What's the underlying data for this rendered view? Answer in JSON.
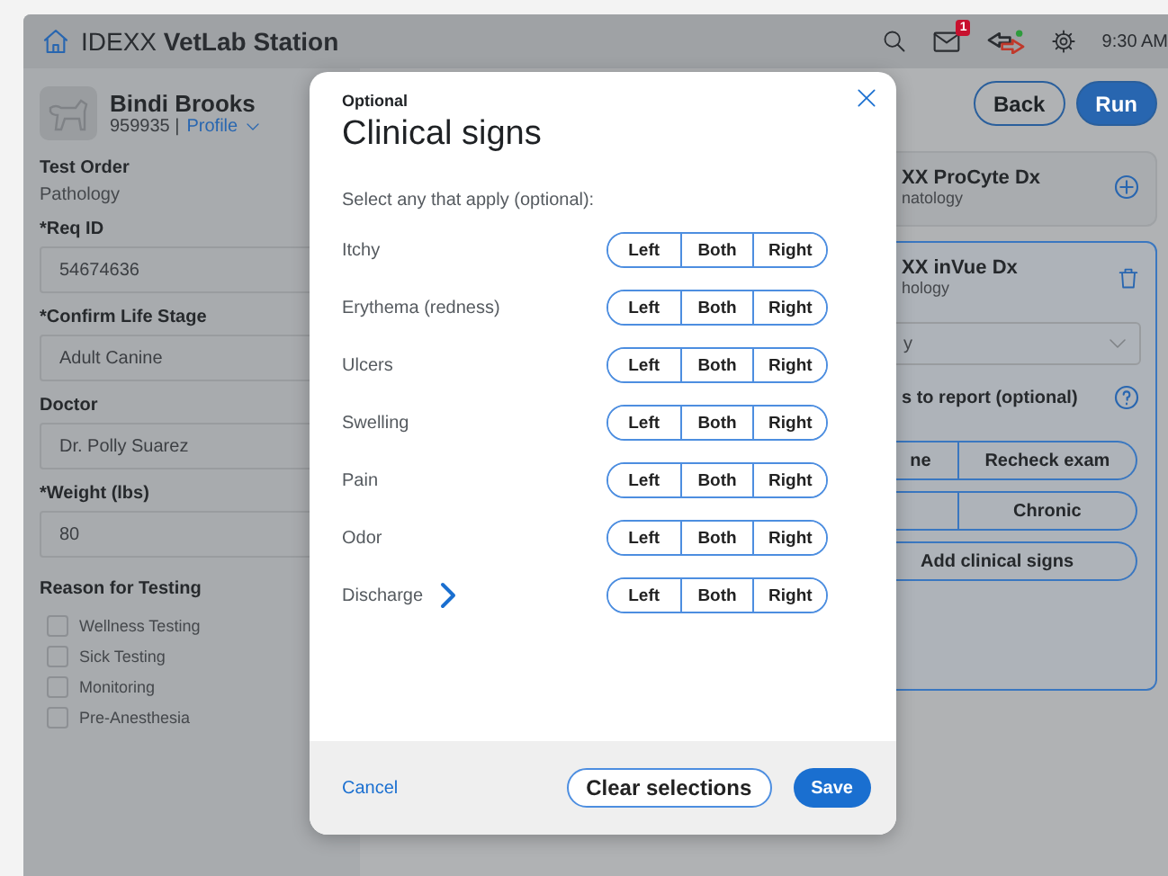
{
  "header": {
    "brand": "IDEXX",
    "product": "VetLab Station",
    "mail_count": "1",
    "time": "9:30 AM"
  },
  "patient": {
    "name": "Bindi Brooks",
    "id": "959935 |",
    "profile_link": "Profile"
  },
  "form": {
    "test_order_label": "Test Order",
    "test_order_value": "Pathology",
    "fields": [
      {
        "label": "*Req ID",
        "value": "54674636"
      },
      {
        "label": "*Confirm Life Stage",
        "value": "Adult Canine"
      },
      {
        "label": "Doctor",
        "value": "Dr. Polly Suarez"
      },
      {
        "label": "*Weight (lbs)",
        "value": "80"
      }
    ],
    "reasons_label": "Reason for Testing",
    "reasons": [
      {
        "label": "Wellness Testing",
        "checked": false
      },
      {
        "label": "Sick Testing",
        "checked": false
      },
      {
        "label": "Monitoring",
        "checked": false
      },
      {
        "label": "Pre-Anesthesia",
        "checked": false
      }
    ]
  },
  "actions": [
    "Back",
    "Run"
  ],
  "cards": [
    {
      "title": "XX ProCyte Dx",
      "subtitle": "natology",
      "kind": "add"
    },
    {
      "title": "XX inVue Dx",
      "subtitle": "hology",
      "kind": "selected",
      "dropdown": "y",
      "report_label": "s to report (optional)",
      "choices": [
        {
          "left": "ne",
          "right": "Recheck exam"
        },
        {
          "right": "Chronic"
        }
      ],
      "add_button": "Add clinical signs"
    }
  ],
  "modal": {
    "eyebrow": "Optional",
    "title": "Clinical signs",
    "instruction": "Select any that apply (optional):",
    "signs": [
      {
        "label": "Itchy",
        "expandable": false,
        "options": [
          {
            "label": "Left",
            "selected": false
          },
          {
            "label": "Both",
            "selected": false
          },
          {
            "label": "Right",
            "selected": false
          }
        ]
      },
      {
        "label": "Erythema (redness)",
        "expandable": false,
        "options": [
          {
            "label": "Left",
            "selected": false
          },
          {
            "label": "Both",
            "selected": false
          },
          {
            "label": "Right",
            "selected": false
          }
        ]
      },
      {
        "label": "Ulcers",
        "expandable": false,
        "options": [
          {
            "label": "Left",
            "selected": false
          },
          {
            "label": "Both",
            "selected": false
          },
          {
            "label": "Right",
            "selected": false
          }
        ]
      },
      {
        "label": "Swelling",
        "expandable": false,
        "options": [
          {
            "label": "Left",
            "selected": false
          },
          {
            "label": "Both",
            "selected": false
          },
          {
            "label": "Right",
            "selected": false
          }
        ]
      },
      {
        "label": "Pain",
        "expandable": false,
        "options": [
          {
            "label": "Left",
            "selected": false
          },
          {
            "label": "Both",
            "selected": false
          },
          {
            "label": "Right",
            "selected": false
          }
        ]
      },
      {
        "label": "Odor",
        "expandable": false,
        "options": [
          {
            "label": "Left",
            "selected": false
          },
          {
            "label": "Both",
            "selected": false
          },
          {
            "label": "Right",
            "selected": false
          }
        ]
      },
      {
        "label": "Discharge",
        "expandable": true,
        "options": [
          {
            "label": "Left",
            "selected": false
          },
          {
            "label": "Both",
            "selected": false
          },
          {
            "label": "Right",
            "selected": false
          }
        ]
      }
    ],
    "cancel": "Cancel",
    "clear": "Clear selections",
    "save": "Save"
  }
}
